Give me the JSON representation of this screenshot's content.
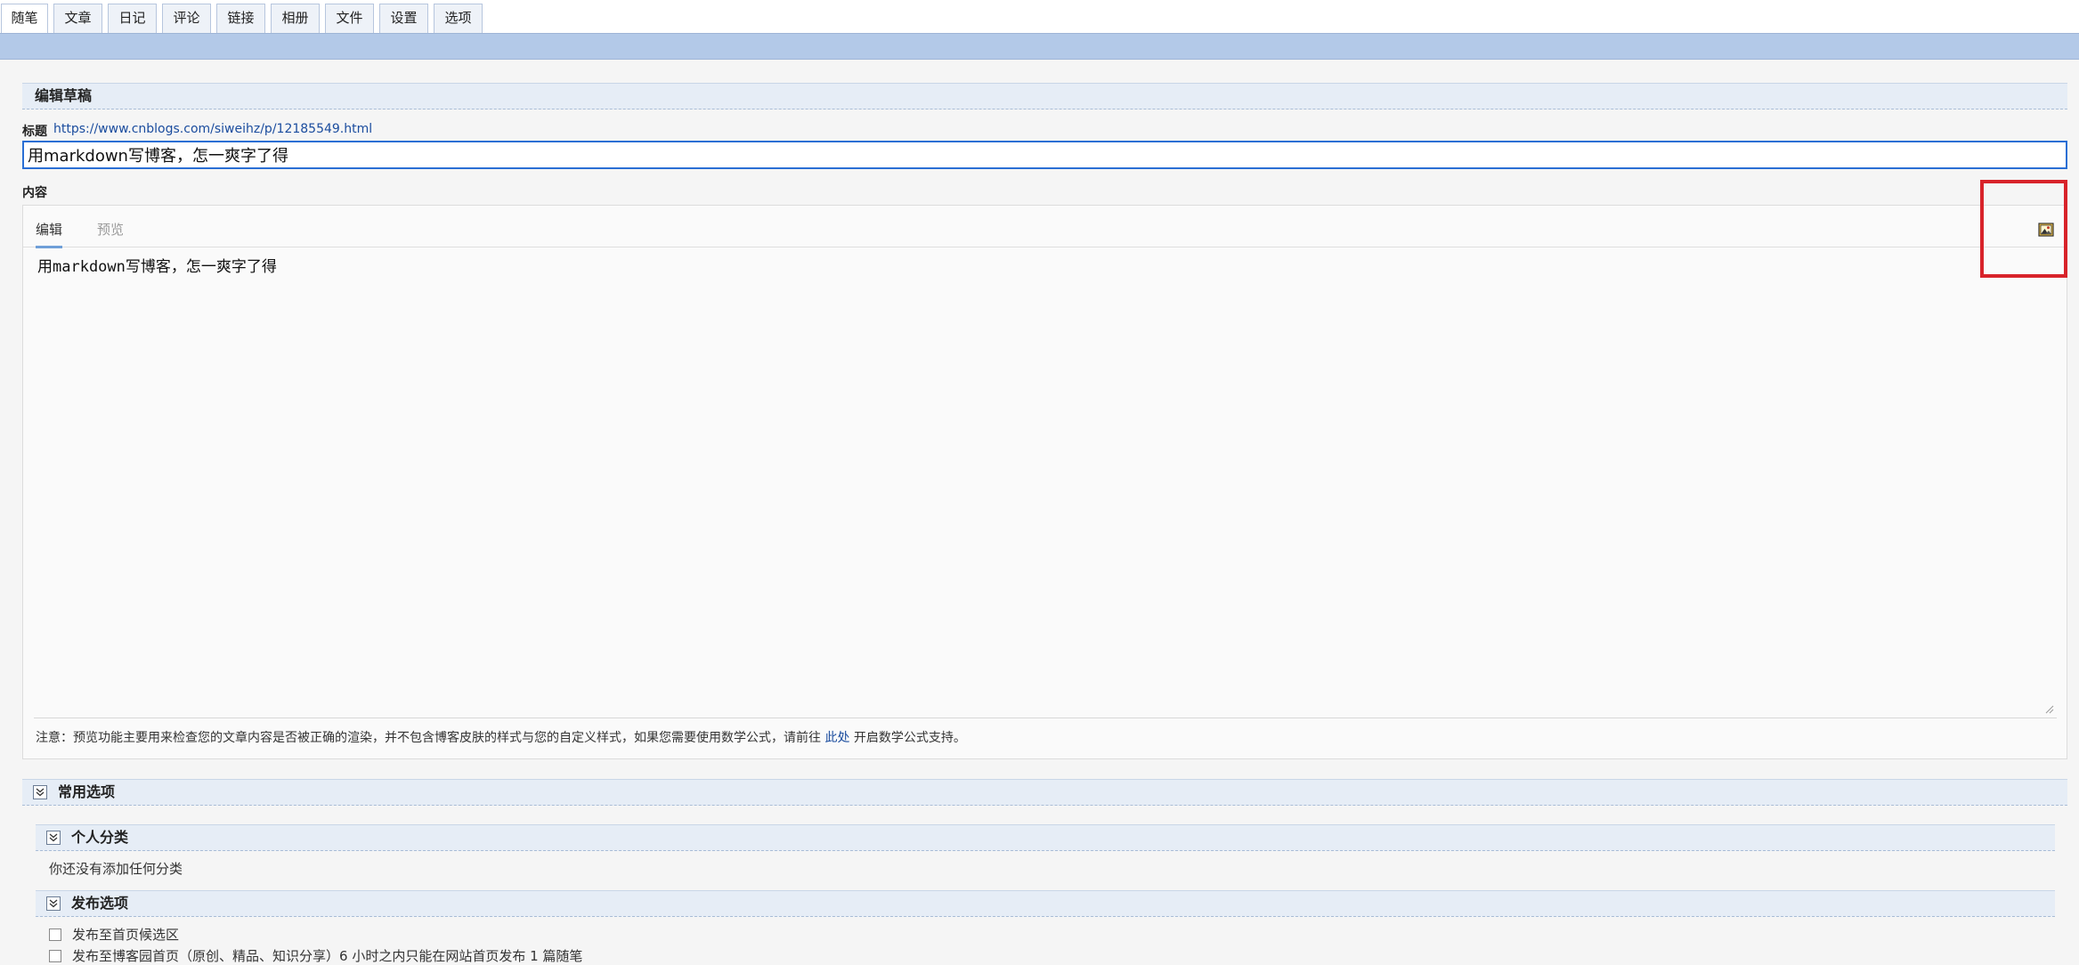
{
  "top_tabs": [
    {
      "label": "随笔",
      "active": true
    },
    {
      "label": "文章",
      "active": false
    },
    {
      "label": "日记",
      "active": false
    },
    {
      "label": "评论",
      "active": false
    },
    {
      "label": "链接",
      "active": false
    },
    {
      "label": "相册",
      "active": false
    },
    {
      "label": "文件",
      "active": false
    },
    {
      "label": "设置",
      "active": false
    },
    {
      "label": "选项",
      "active": false
    }
  ],
  "edit_draft": {
    "heading": "编辑草稿"
  },
  "title_field": {
    "label": "标题",
    "link_text": "https://www.cnblogs.com/siweihz/p/12185549.html",
    "value": "用markdown写博客，怎一爽字了得"
  },
  "content_field": {
    "label": "内容",
    "tabs": [
      {
        "label": "编辑",
        "active": true
      },
      {
        "label": "预览",
        "active": false
      }
    ],
    "image_icon": "image-icon",
    "value": "用markdown写博客，怎一爽字了得",
    "note_prefix": "注意：预览功能主要用来检查您的文章内容是否被正确的渲染，并不包含博客皮肤的样式与您的自定义样式，如果您需要使用数学公式，请前往",
    "note_link": "此处",
    "note_suffix": "开启数学公式支持。"
  },
  "common_options": {
    "heading": "常用选项"
  },
  "personal_category": {
    "heading": "个人分类",
    "empty_text": "你还没有添加任何分类"
  },
  "publish_options": {
    "heading": "发布选项",
    "options": [
      {
        "label": "发布至首页候选区",
        "checked": false
      },
      {
        "label": "发布至博客园首页（原创、精品、知识分享）6 小时之内只能在网站首页发布 1 篇随笔",
        "checked": false
      }
    ]
  },
  "colors": {
    "accent_blue": "#2a6fd4",
    "band_blue": "#b3c9e8",
    "highlight_red": "#d8232a",
    "link_blue": "#1a4c9e"
  }
}
